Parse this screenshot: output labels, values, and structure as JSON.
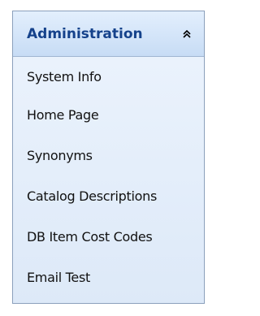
{
  "panel": {
    "title": "Administration",
    "collapse_icon": "double-chevron-up-icon",
    "items": [
      {
        "label": "System Info"
      },
      {
        "label": "Home Page"
      },
      {
        "label": "Synonyms"
      },
      {
        "label": "Catalog Descriptions"
      },
      {
        "label": "DB Item Cost Codes"
      },
      {
        "label": "Email Test"
      }
    ]
  },
  "colors": {
    "header_text": "#15428b",
    "header_bg_top": "#e3effd",
    "header_bg_bottom": "#c7dcf5",
    "body_bg": "#eaf2fc",
    "border": "#8ba0bc",
    "item_text": "#111111"
  }
}
